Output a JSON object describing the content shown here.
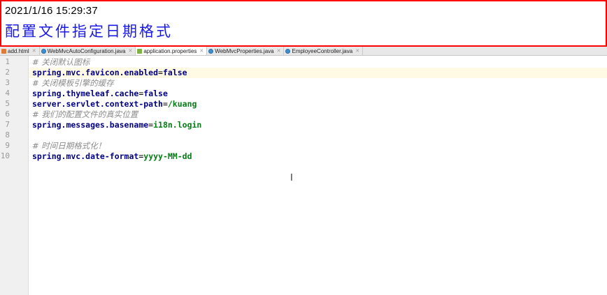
{
  "banner": {
    "timestamp": "2021/1/16 15:29:37",
    "title": "配置文件指定日期格式"
  },
  "tabs": [
    {
      "label": "add.html",
      "icon": "html-file-icon"
    },
    {
      "label": "WebMvcAutoConfiguration.java",
      "icon": "java-class-icon"
    },
    {
      "label": "application.properties",
      "icon": "properties-file-icon",
      "active": true
    },
    {
      "label": "WebMvcProperties.java",
      "icon": "java-class-icon"
    },
    {
      "label": "EmployeeController.java",
      "icon": "java-class-icon"
    }
  ],
  "editor": {
    "line_numbers": [
      "1",
      "2",
      "3",
      "4",
      "5",
      "6",
      "7",
      "8",
      "9",
      "10"
    ],
    "lines": [
      {
        "comment": "# 关闭默认图标"
      },
      {
        "key": "spring.mvc.favicon.enabled",
        "eq": "=",
        "value": "false",
        "highlighted": true
      },
      {
        "comment": "# 关闭模板引擎的缓存"
      },
      {
        "key": "spring.thymeleaf.cache",
        "eq": "=",
        "value": "false"
      },
      {
        "key": "server.servlet.context-path",
        "eq": "=",
        "value": "/kuang"
      },
      {
        "comment": "# 我们的配置文件的真实位置"
      },
      {
        "key": "spring.messages.basename",
        "eq": "=",
        "value": "i18n.login"
      },
      {},
      {
        "comment": "# 时间日期格式化！"
      },
      {
        "key": "spring.mvc.date-format",
        "eq": "=",
        "value": "yyyy-MM-dd"
      }
    ]
  },
  "colors": {
    "banner_border": "#ff0000",
    "title_text": "#1a1ae8",
    "comment": "#8c8c8c",
    "key": "#000080",
    "value": "#067d17",
    "current_line": "#fffae3"
  },
  "cursor_icon": "text-cursor-icon"
}
